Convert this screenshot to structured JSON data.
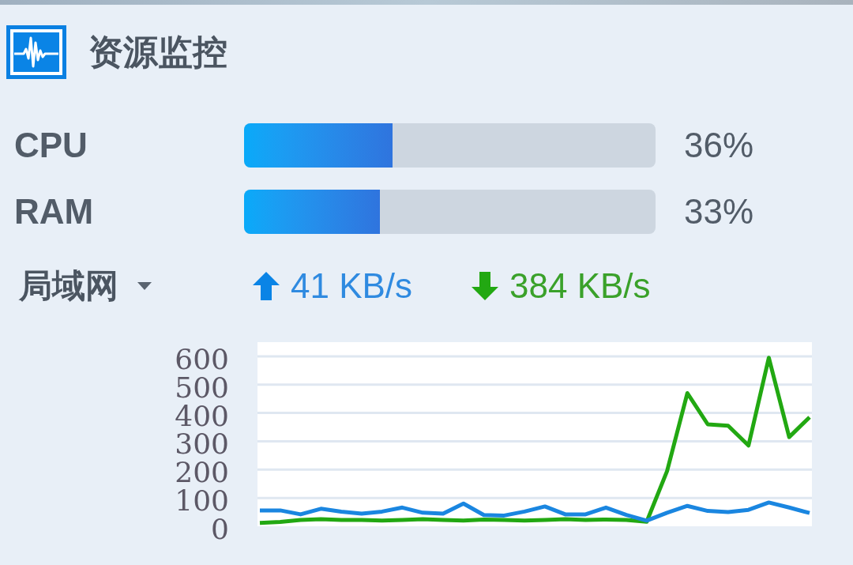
{
  "widget": {
    "title": "资源监控"
  },
  "meters": [
    {
      "label": "CPU",
      "level": 0.36,
      "reading": "36%"
    },
    {
      "label": "RAM",
      "level": 0.33,
      "reading": "33%"
    }
  ],
  "network": {
    "interface": "局域网",
    "upload": "41 KB/s",
    "download": "384 KB/s",
    "chart_data": {
      "type": "line",
      "categories": [
        null,
        null,
        null,
        null,
        null,
        null,
        null,
        null,
        null,
        null,
        null,
        null,
        null,
        null,
        null,
        null,
        null,
        null,
        null,
        null,
        null,
        null,
        null,
        null,
        null,
        null,
        null,
        null
      ],
      "series": [
        {
          "color": "#1a86e0",
          "values": [
            56,
            56,
            42,
            62,
            52,
            45,
            52,
            66,
            48,
            45,
            80,
            40,
            38,
            52,
            70,
            42,
            42,
            66,
            40,
            20,
            48,
            72,
            54,
            50,
            58,
            84,
            66,
            47
          ]
        },
        {
          "color": "#22a812",
          "values": [
            12,
            15,
            22,
            25,
            22,
            22,
            20,
            22,
            25,
            22,
            20,
            24,
            22,
            20,
            22,
            25,
            22,
            24,
            22,
            16,
            195,
            470,
            360,
            355,
            285,
            595,
            315,
            385
          ]
        }
      ],
      "ylim": [
        0,
        650
      ],
      "yticks": [
        0,
        100,
        200,
        300,
        400,
        500,
        600
      ],
      "tick_labels": "y",
      "grid": true
    }
  }
}
